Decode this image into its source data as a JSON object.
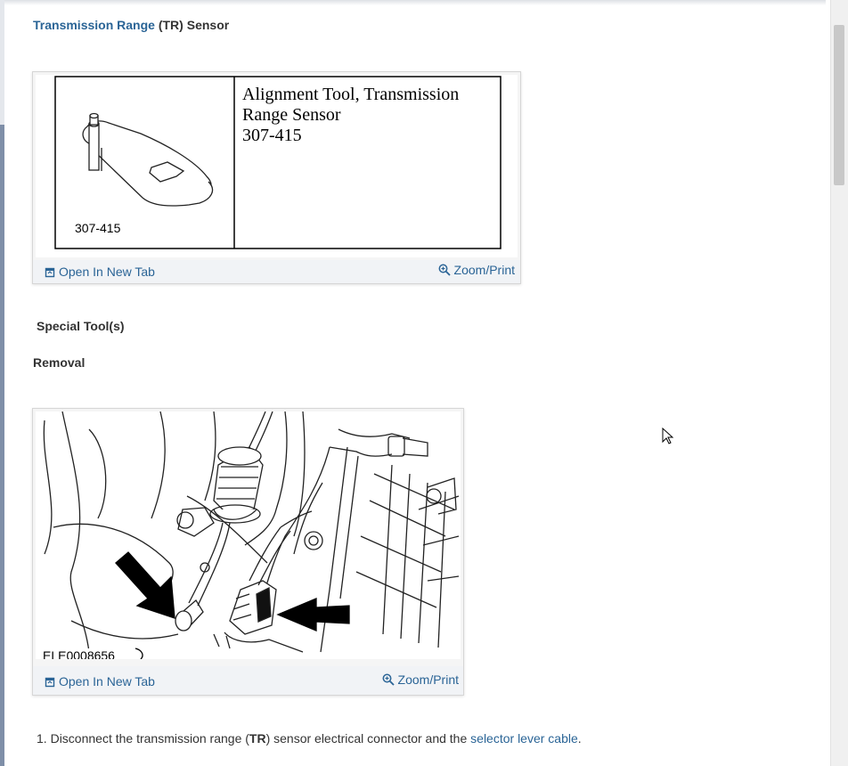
{
  "header": {
    "title_link": "Transmission Range",
    "title_abbr_open": " (",
    "title_abbr": "TR",
    "title_abbr_close": ")",
    "title_rest": " Sensor"
  },
  "figure1": {
    "tool_number": "307-415",
    "tool_name_line1": "Alignment Tool, Transmission",
    "tool_name_line2": "Range Sensor",
    "tool_name_line3": "307-415",
    "open_label": "Open In New Tab",
    "zoom_label": "Zoom/Print"
  },
  "section1": {
    "label": "Special Tool(s)"
  },
  "section2": {
    "label": "Removal"
  },
  "figure2": {
    "image_code": "ELE0008656",
    "open_label": "Open In New Tab",
    "zoom_label": "Zoom/Print"
  },
  "steps": [
    {
      "number": "1.",
      "text_a": "Disconnect the transmission range (",
      "abbr": "TR",
      "text_b": ") sensor electrical connector and the ",
      "link": "selector lever cable",
      "text_c": "."
    }
  ]
}
